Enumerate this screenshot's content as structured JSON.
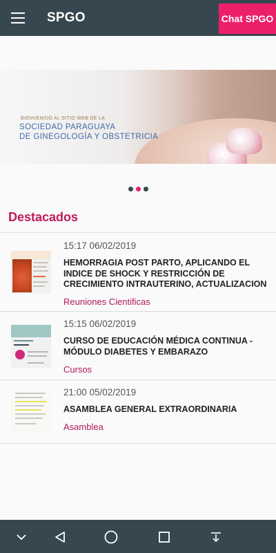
{
  "app": {
    "title": "SPGO",
    "chat_label": "Chat SPGO"
  },
  "banner": {
    "small_text": "BIENVENIDO AL SITIO WEB DE LA",
    "line1": "SOCIEDAD PARAGUAYA",
    "line2": "DE GINEGOLOGÍA Y OBSTETRICIA"
  },
  "carousel": {
    "dot_count": 3,
    "active_index": 1
  },
  "section": {
    "title": "Destacados"
  },
  "items": [
    {
      "time": "15:17 06/02/2019",
      "title": "HEMORRAGIA POST PARTO, APLICANDO EL INDICE DE SHOCK Y RESTRICCIÓN DE CRECIMIENTO INTRAUTERINO, ACTUALIZACION",
      "category": "Reuniones Cientificas"
    },
    {
      "time": "15:15 06/02/2019",
      "title": "CURSO DE EDUCACIÓN MÉDICA CONTINUA - MÓDULO DIABETES Y EMBARAZO",
      "category": "Cursos"
    },
    {
      "time": "21:00 05/02/2019",
      "title": "ASAMBLEA GENERAL EXTRAORDINARIA",
      "category": "Asamblea"
    }
  ],
  "colors": {
    "appbar": "#37474f",
    "accent": "#ec1f6a",
    "section_title": "#c2185b",
    "category": "#b0195a"
  },
  "icons": {
    "menu": "hamburger-menu-icon",
    "nav_down": "chevron-down-icon",
    "nav_back": "back-triangle-icon",
    "nav_home": "home-circle-icon",
    "nav_recent": "recent-apps-square-icon",
    "nav_extra": "notification-pull-icon"
  }
}
